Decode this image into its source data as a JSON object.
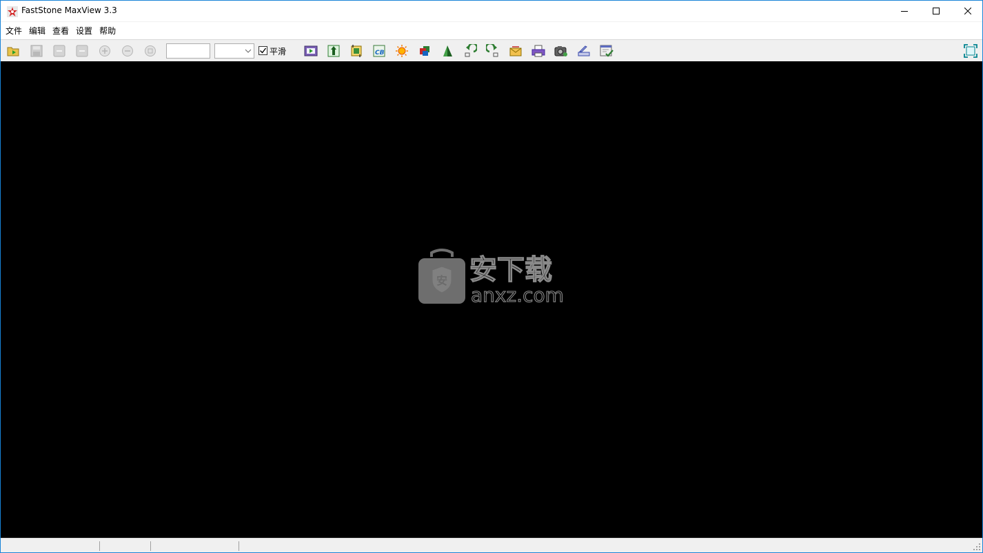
{
  "window": {
    "title": "FastStone MaxView 3.3",
    "accent_color": "#1883d7"
  },
  "menu": {
    "items": [
      {
        "label": "文件"
      },
      {
        "label": "编辑"
      },
      {
        "label": "查看"
      },
      {
        "label": "设置"
      },
      {
        "label": "帮助"
      }
    ]
  },
  "toolbar": {
    "buttons": [
      {
        "icon": "open-folder-icon",
        "enabled": true
      },
      {
        "icon": "save-icon",
        "enabled": false
      },
      {
        "icon": "previous-icon",
        "enabled": false
      },
      {
        "icon": "next-icon",
        "enabled": false
      },
      {
        "icon": "zoom-in-icon",
        "enabled": false
      },
      {
        "icon": "zoom-out-icon",
        "enabled": false
      },
      {
        "icon": "actual-size-icon",
        "enabled": false
      },
      {
        "icon": "slideshow-icon",
        "enabled": true
      },
      {
        "icon": "resize-icon",
        "enabled": true
      },
      {
        "icon": "crop-icon",
        "enabled": true
      },
      {
        "icon": "color-balance-icon",
        "enabled": true
      },
      {
        "icon": "brightness-icon",
        "enabled": true
      },
      {
        "icon": "colors-icon",
        "enabled": true
      },
      {
        "icon": "sharpen-icon",
        "enabled": true
      },
      {
        "icon": "rotate-left-icon",
        "enabled": true
      },
      {
        "icon": "rotate-right-icon",
        "enabled": true
      },
      {
        "icon": "email-icon",
        "enabled": true
      },
      {
        "icon": "print-icon",
        "enabled": true
      },
      {
        "icon": "capture-icon",
        "enabled": true
      },
      {
        "icon": "scanner-icon",
        "enabled": true
      },
      {
        "icon": "settings-check-icon",
        "enabled": true
      },
      {
        "icon": "fullscreen-icon",
        "enabled": true
      }
    ],
    "zoom_value": "",
    "zoom_select_value": "",
    "smooth_label": "平滑",
    "smooth_checked": true
  },
  "viewer": {
    "background": "#000000",
    "watermark_text": "安下载",
    "watermark_domain": "anxz.com",
    "watermark_badge": "安"
  },
  "statusbar": {
    "segments": [
      "",
      "",
      "",
      ""
    ]
  }
}
